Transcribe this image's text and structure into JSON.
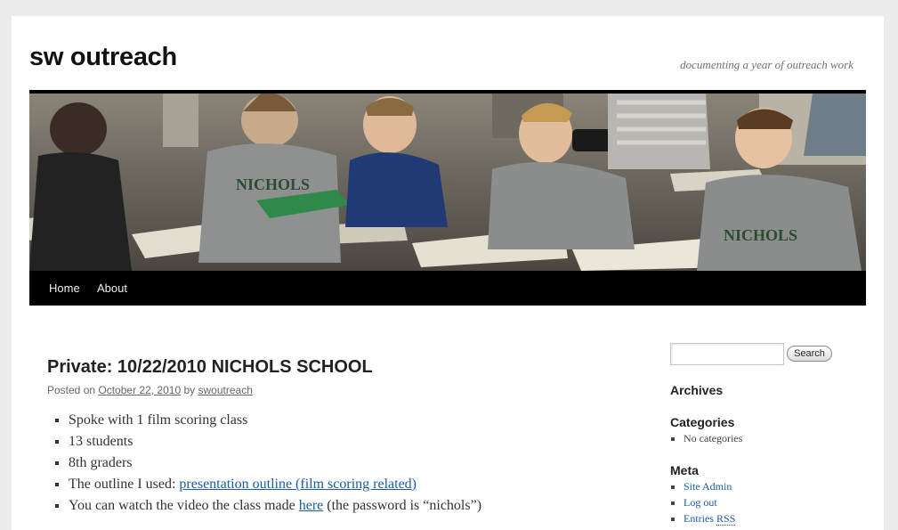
{
  "site": {
    "title": "sw outreach",
    "description": "documenting a year of outreach work"
  },
  "nav": {
    "items": [
      {
        "label": "Home"
      },
      {
        "label": "About"
      }
    ]
  },
  "post": {
    "title": "Private: 10/22/2010 NICHOLS SCHOOL",
    "meta_prefix": "Posted on",
    "date": "October 22, 2010",
    "meta_by": "by",
    "author": "swoutreach",
    "bullets": {
      "b1": "Spoke with 1 film scoring class",
      "b2": "13 students",
      "b3": "8th graders",
      "b4_text": "The outline I used:",
      "b4_link": "presentation outline (film scoring related)",
      "b5_text": "You can watch the video the class made",
      "b5_link": "here",
      "b5_suffix": "(the password is “nichols”)"
    }
  },
  "sidebar": {
    "search_button": "Search",
    "search_placeholder": "",
    "archives_title": "Archives",
    "categories_title": "Categories",
    "categories_empty": "No categories",
    "meta_title": "Meta",
    "meta_links": {
      "site_admin": "Site Admin",
      "log_out": "Log out",
      "entries": "Entries",
      "rss": "RSS"
    }
  },
  "colors": {
    "link": "#1b5ba8",
    "nav_bg": "#000000",
    "page_bg": "#ececec"
  }
}
